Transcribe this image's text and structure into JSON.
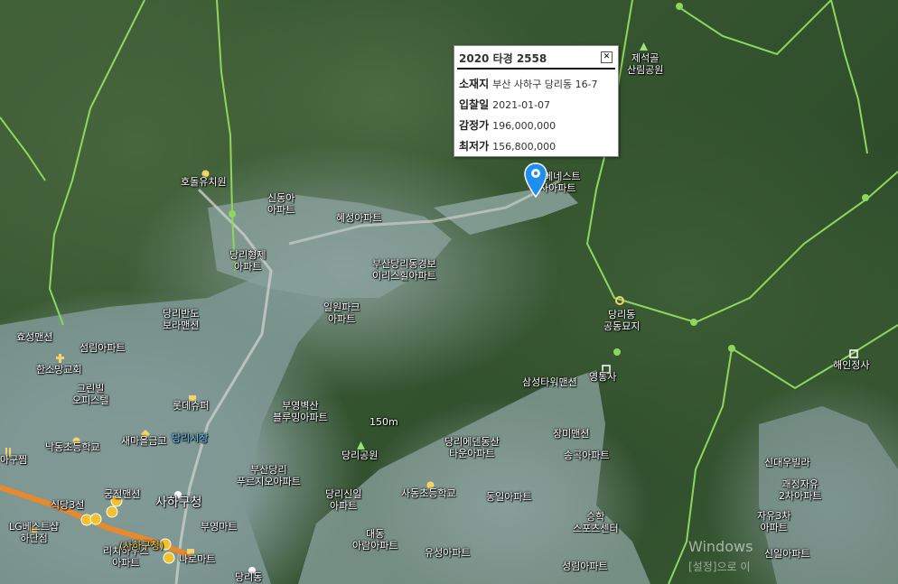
{
  "popup": {
    "title": "2020 타경 2558",
    "close_symbol": "✕",
    "rows": [
      {
        "label": "소재지",
        "value": "부산 사하구 당리동 16-7"
      },
      {
        "label": "입찰일",
        "value": "2021-01-07"
      },
      {
        "label": "감정가",
        "value": "196,000,000"
      },
      {
        "label": "최저가",
        "value": "156,800,000"
      }
    ]
  },
  "marker": {
    "icon": "location-pin-icon",
    "color": "#1e8ef0"
  },
  "colors": {
    "trail": "#8fd65c",
    "road_orange": "#e8892b",
    "station": "#f2c12e"
  },
  "labels": {
    "jeseokgol": "제석골\n산림공원",
    "hodol": "호돌유치원",
    "sindonga": "신동아\n아파트",
    "hyeseong": "혜성아파트",
    "danglihyeongje": "당리형제\n아파트",
    "busandangli_kyungbo": "부산당리동경보\n이리스힐아파트",
    "ilwonpark": "일원파크\n아파트",
    "dangliban": "당리반도\n보라맨션",
    "hyoseong": "효성맨션",
    "seorim": "섬림아파트",
    "hansomang": "한소망교회",
    "greenvil": "그린빌\n오피스텔",
    "lotte": "롯데슈퍼",
    "nakdong": "낙동초등학교",
    "saemaeul": "새마을금고",
    "danglisijang": "당리시장",
    "buyeong_blue": "부영벽산\n블루밍아파트",
    "m150": "150m",
    "dangli_park": "당리공원",
    "busandangli_prugio": "부산당리\n푸르지오아파트",
    "dangli_sinil": "당리신일\n아파트",
    "sadong_school": "사동초등학교",
    "dangli_edenvil": "당리에덴동산\n타운아파트",
    "samsung_tower": "삼성타워맨션",
    "yeongtongsa": "영통사",
    "dangli_cemetery": "당리동\n공동묘지",
    "haeinjeongsa": "해인정사",
    "jangmi": "장미맨션",
    "songjuk": "송곡아파트",
    "dongil": "동일아파트",
    "daedong_arim": "대동\n아람아파트",
    "yuseong": "유성아파트",
    "seongrim": "성림아파트",
    "seunghak_sports": "승학\n스포츠센터",
    "sindae_urbil": "신대우빌라",
    "gwajeong_jayu": "괘정자유\n2차아파트",
    "jayu3": "자유3차\n아파트",
    "sinil_bottom": "신일아파트",
    "gungjeon": "궁전맨션",
    "sahagu_office": "사하구청",
    "buyeong_mart": "부영마트",
    "lg_best": "LG베스트샵\n하단점",
    "sikdang": "식당3선",
    "richi": "리치하우스\n아파트",
    "naro": "나로마트",
    "danglidong_bottom": "당리동",
    "iapatu_zzim": "아구찜",
    "pin_apt": "원베네스트\n사아파트",
    "station_sahagu": "(사하구청)"
  },
  "watermark": {
    "line1": "Windows",
    "line2": "[설정]으로 이"
  }
}
